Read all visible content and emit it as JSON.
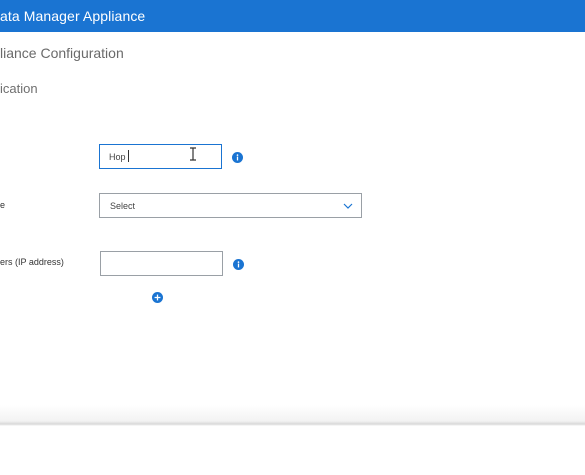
{
  "header": {
    "title": "ata Manager Appliance"
  },
  "page": {
    "title": "liance Configuration",
    "section_title": "ication"
  },
  "form": {
    "field1": {
      "value": "Hop"
    },
    "field2": {
      "label": "e",
      "selected": "Select"
    },
    "field3": {
      "label": "ers (IP address)",
      "value": ""
    }
  },
  "icons": {
    "info": "info-icon",
    "add": "add-circle-icon",
    "chevron": "chevron-down-icon",
    "cursor": "text-cursor-icon"
  },
  "colors": {
    "accent": "#1a74d2",
    "header_text": "#ffffff",
    "border": "#9aa0a6"
  }
}
